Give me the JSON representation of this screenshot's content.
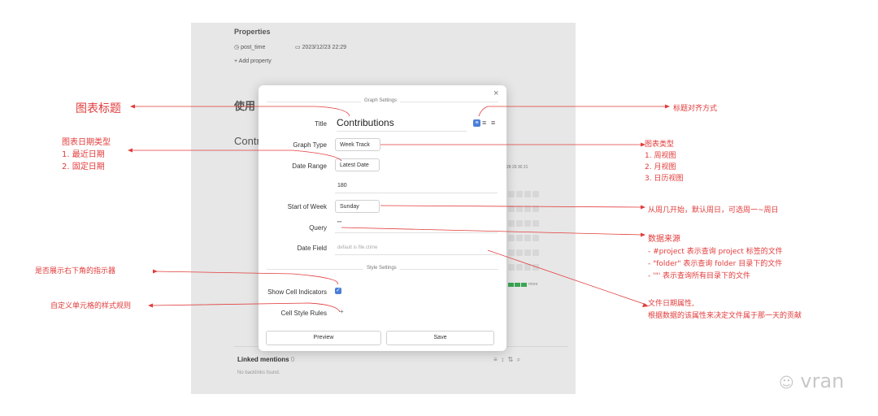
{
  "note": {
    "properties_heading": "Properties",
    "post_time_label": "post_time",
    "post_time_value": "2023/12/23 22:29",
    "add_property": "+ Add property",
    "heading_use": "使用",
    "heading_contrib": "Contri",
    "week_days": "28  29  30  21",
    "more_label": "more",
    "linked_mentions": "Linked mentions",
    "linked_count": "0",
    "no_backlinks": "No backlinks found."
  },
  "modal": {
    "header": "Graph Settings",
    "close": "×",
    "title_label": "Title",
    "title_value": "Contributions",
    "graph_type_label": "Graph Type",
    "graph_type_value": "Week Track",
    "date_range_label": "Date Range",
    "date_range_value": "Latest Date",
    "date_range_days": "180",
    "start_of_week_label": "Start of Week",
    "start_of_week_value": "Sunday",
    "query_label": "Query",
    "query_value": "\"\"",
    "date_field_label": "Date Field",
    "date_field_placeholder": "default is file.ctime",
    "style_settings": "Style Settings",
    "show_cell_indicators_label": "Show Cell Indicators",
    "show_cell_indicators_checked": true,
    "cell_style_rules_label": "Cell Style Rules",
    "cell_style_rules_add": "+",
    "preview_button": "Preview",
    "save_button": "Save"
  },
  "annotations": {
    "chart_title": "图表标题",
    "align": "标题对齐方式",
    "date_type_title": "图表日期类型",
    "date_type_1": "1.  最近日期",
    "date_type_2": "2.  固定日期",
    "chart_type_title": "图表类型",
    "chart_type_1": "1.   周视图",
    "chart_type_2": "2.   月视图",
    "chart_type_3": "3.   日历视图",
    "week_start": "从周几开始，默认周日，可选周一~周日",
    "data_source_title": "数据来源",
    "data_source_1": "- #project  表示查询 project 标签的文件",
    "data_source_2": "- \"folder\" 表示查询 folder 目录下的文件",
    "data_source_3": "- '\"'  表示查询所有目录下的文件",
    "show_indicator": "是否展示右下角的指示器",
    "cell_rules": "自定义单元格的样式规则",
    "date_field_1": "文件日期属性,",
    "date_field_2": "根据数据的该属性来决定文件属于那一天的贡献"
  },
  "watermark": "vran",
  "colors": {
    "annotation": "#e23b3b",
    "accent": "#4a7fd8",
    "cell_active": "#3aa654"
  }
}
